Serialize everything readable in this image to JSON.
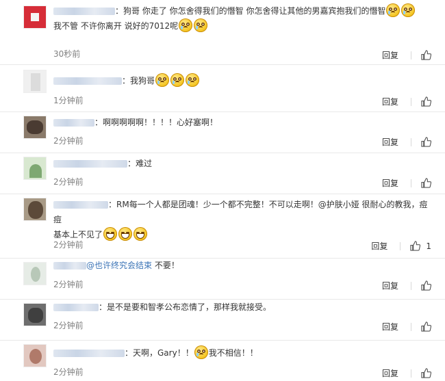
{
  "comments": [
    {
      "username_width": 90,
      "avatar_style": "red",
      "text1": "：狗哥 你走了 你怎舍得我们的憯智 你怎舍得让其他的男嘉宾抱我们的憯智",
      "text2": "我不管 不许你离开 说好的7012呢",
      "emoji_after1": "sad-face-icon",
      "emoji_after2": "sad-face-icon",
      "time": "30秒前",
      "reply": "回复",
      "likes": ""
    },
    {
      "username_width": 100,
      "text1": "：我狗哥",
      "time": "1分钟前",
      "reply": "回复",
      "likes": ""
    },
    {
      "username_width": 60,
      "text1": "：啊啊啊啊啊！！！！心好塞啊！",
      "time": "2分钟前",
      "reply": "回复",
      "likes": ""
    },
    {
      "username_width": 108,
      "text1": "：难过",
      "time": "2分钟前",
      "reply": "回复",
      "likes": ""
    },
    {
      "username_width": 80,
      "text1": "：RM每一个人都是团魂！少一个都不完整！不可以走啊！",
      "mention": "@护肤小娅",
      "text1b": " 很耐心的教我，痘痘",
      "text2": "基本上不见了",
      "time": "2分钟前",
      "reply": "回复",
      "likes": "1"
    },
    {
      "username_width": 48,
      "mention": "@也许终究会结束",
      "text1": " 不要！",
      "time": "2分钟前",
      "reply": "回复",
      "likes": ""
    },
    {
      "username_width": 66,
      "text1": "：是不是要和智孝公布恋情了，那样我就接受。",
      "time": "2分钟前",
      "reply": "回复",
      "likes": ""
    },
    {
      "username_width": 104,
      "text1": "：天啊，Gary！！",
      "text2": "我不相信！！",
      "time": "2分钟前",
      "reply": "回复",
      "likes": ""
    }
  ]
}
